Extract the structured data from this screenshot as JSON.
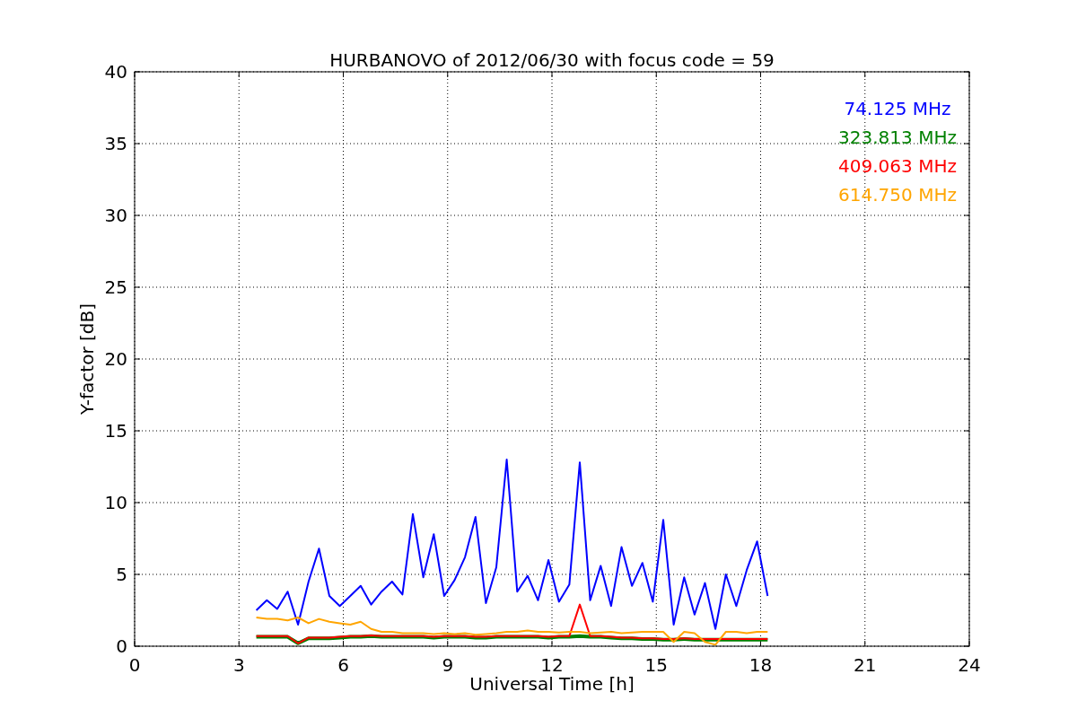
{
  "chart_data": {
    "type": "line",
    "title": "HURBANOVO of 2012/06/30 with focus code = 59",
    "xlabel": "Universal Time [h]",
    "ylabel": "Y-factor [dB]",
    "x": [
      3.5,
      3.8,
      4.1,
      4.4,
      4.7,
      5.0,
      5.3,
      5.6,
      5.9,
      6.2,
      6.5,
      6.8,
      7.1,
      7.4,
      7.7,
      8.0,
      8.3,
      8.6,
      8.9,
      9.2,
      9.5,
      9.8,
      10.1,
      10.4,
      10.7,
      11.0,
      11.3,
      11.6,
      11.9,
      12.2,
      12.5,
      12.8,
      13.1,
      13.4,
      13.7,
      14.0,
      14.3,
      14.6,
      14.9,
      15.2,
      15.5,
      15.8,
      16.1,
      16.4,
      16.7,
      17.0,
      17.3,
      17.6,
      17.9,
      18.2
    ],
    "series": [
      {
        "name": "74.125 MHz",
        "color": "#0000ff",
        "values": [
          2.5,
          3.2,
          2.6,
          3.8,
          1.5,
          4.5,
          6.8,
          3.5,
          2.8,
          3.5,
          4.2,
          2.9,
          3.8,
          4.5,
          3.6,
          9.2,
          4.8,
          7.8,
          3.5,
          4.6,
          6.2,
          9.0,
          3.0,
          5.5,
          13.0,
          3.8,
          4.9,
          3.2,
          6.0,
          3.1,
          4.3,
          12.8,
          3.2,
          5.6,
          2.8,
          6.9,
          4.2,
          5.8,
          3.1,
          8.8,
          1.5,
          4.8,
          2.2,
          4.4,
          1.2,
          5.0,
          2.8,
          5.3,
          7.3,
          3.5
        ]
      },
      {
        "name": "323.813 MHz",
        "color": "#008000",
        "values": [
          0.65,
          0.65,
          0.65,
          0.65,
          0.2,
          0.55,
          0.55,
          0.55,
          0.6,
          0.65,
          0.65,
          0.7,
          0.65,
          0.65,
          0.65,
          0.65,
          0.65,
          0.6,
          0.65,
          0.65,
          0.65,
          0.6,
          0.6,
          0.65,
          0.65,
          0.65,
          0.65,
          0.65,
          0.6,
          0.65,
          0.65,
          0.7,
          0.65,
          0.65,
          0.6,
          0.55,
          0.55,
          0.5,
          0.5,
          0.45,
          0.45,
          0.5,
          0.45,
          0.45,
          0.45,
          0.45,
          0.45,
          0.45,
          0.45,
          0.45
        ]
      },
      {
        "name": "409.063 MHz",
        "color": "#ff0000",
        "values": [
          0.7,
          0.7,
          0.7,
          0.7,
          0.2,
          0.6,
          0.6,
          0.6,
          0.65,
          0.7,
          0.7,
          0.75,
          0.7,
          0.7,
          0.7,
          0.7,
          0.7,
          0.65,
          0.7,
          0.7,
          0.7,
          0.65,
          0.65,
          0.7,
          0.7,
          0.7,
          0.7,
          0.7,
          0.65,
          0.7,
          0.7,
          2.9,
          0.7,
          0.7,
          0.65,
          0.6,
          0.6,
          0.55,
          0.55,
          0.5,
          0.5,
          0.55,
          0.5,
          0.5,
          0.5,
          0.5,
          0.5,
          0.5,
          0.5,
          0.5
        ]
      },
      {
        "name": "614.750 MHz",
        "color": "#ffa500",
        "values": [
          2.0,
          1.9,
          1.9,
          1.8,
          2.0,
          1.6,
          1.9,
          1.7,
          1.6,
          1.5,
          1.7,
          1.2,
          1.0,
          1.0,
          0.9,
          0.9,
          0.9,
          0.85,
          0.9,
          0.85,
          0.9,
          0.8,
          0.85,
          0.9,
          1.0,
          1.0,
          1.1,
          1.0,
          1.0,
          0.95,
          1.0,
          1.0,
          0.9,
          0.95,
          1.0,
          0.9,
          0.95,
          1.0,
          1.0,
          1.0,
          0.3,
          1.0,
          0.9,
          0.3,
          0.1,
          1.0,
          1.0,
          0.9,
          1.0,
          1.0
        ]
      }
    ],
    "grid": true,
    "xlim": [
      0,
      24
    ],
    "ylim": [
      0,
      40
    ],
    "xticks": [
      0,
      3,
      6,
      9,
      12,
      15,
      18,
      21,
      24
    ],
    "yticks": [
      0,
      5,
      10,
      15,
      20,
      25,
      30,
      35,
      40
    ]
  }
}
